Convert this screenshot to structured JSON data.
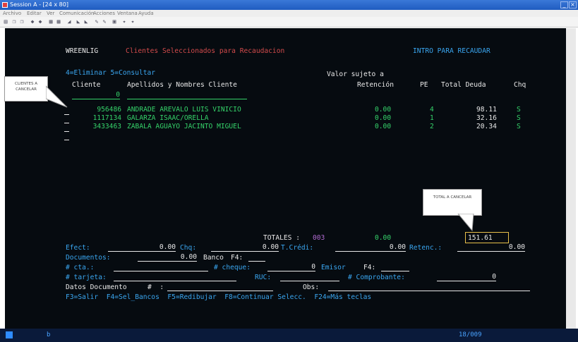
{
  "window": {
    "title": "Session A - [24 x 80]"
  },
  "menu": [
    "Archivo",
    "Editar",
    "Ver",
    "Comunicación",
    "Acciones",
    "Ventana",
    "Ayuda"
  ],
  "toolbar_icons": [
    "print-icon",
    "copy-icon",
    "paste-icon",
    "send-icon",
    "receive-icon",
    "display-icon",
    "keyboard-icon",
    "macro-icon",
    "record-icon",
    "play-icon",
    "color-icon",
    "map-icon",
    "help-icon",
    "settings-icon"
  ],
  "screen": {
    "program": "WREENLIG",
    "title": "Clientes Seleccionados para Recaudacion",
    "hint": "INTRO PARA RECAUDAR",
    "options": "4=Eliminar 5=Consultar",
    "col_headers": {
      "valor_line1": "Valor sujeto a",
      "cliente": "Cliente",
      "nombres": "Apellidos y Nombres Cliente",
      "retencion": "Retención",
      "pe": "PE",
      "total_deuda": "Total Deuda",
      "chq": "Chq"
    },
    "filter_value": "0",
    "rows": [
      {
        "cliente": "956486",
        "nombre": "ANDRADE AREVALO LUIS VINICIO",
        "retencion": "0.00",
        "pe": "4",
        "deuda": "98.11",
        "chq": "S"
      },
      {
        "cliente": "1117134",
        "nombre": "GALARZA ISAAC/ORELLA",
        "retencion": "0.00",
        "pe": "1",
        "deuda": "32.16",
        "chq": "S"
      },
      {
        "cliente": "3433463",
        "nombre": "ZABALA AGUAYO JACINTO MIGUEL",
        "retencion": "0.00",
        "pe": "2",
        "deuda": "20.34",
        "chq": "S"
      }
    ],
    "totales": {
      "label": "TOTALES :",
      "count": "003",
      "retencion": "0.00",
      "deuda": "151.61"
    },
    "pago": {
      "efect_label": "Efect:",
      "efect": "0.00",
      "chq_label": "Chq:",
      "chq": "0.00",
      "tcredi_label": "T.Crédi:",
      "tcredi": "0.00",
      "retenc_label": "Retenc.:",
      "retenc": "0.00"
    },
    "documentos": {
      "label": "Documentos:",
      "value": "0.00",
      "banco_label": "Banco",
      "f4": "F4:"
    },
    "cuenta": {
      "cta_label": "# cta.:",
      "cheque_label": "# cheque:",
      "cheque": "0",
      "emisor_label": "Emisor",
      "f4": "F4:"
    },
    "tarjeta": {
      "label": "# tarjeta:",
      "ruc_label": "RUC:",
      "comprobante_label": "# Comprobante:",
      "comprobante": "0"
    },
    "datos": {
      "label": "Datos Documento",
      "num": "#  :",
      "obs": "Obs:"
    },
    "fkeys": "F3=Salir  F4=Sel_Bancos  F5=Redibujar  F8=Continuar Selecc.  F24=Más teclas"
  },
  "callouts": {
    "clientes": "CLIENTES A CANCELAR",
    "total": "TOTAL A CANCELAR"
  },
  "status": {
    "left": "b",
    "right": "18/009"
  }
}
